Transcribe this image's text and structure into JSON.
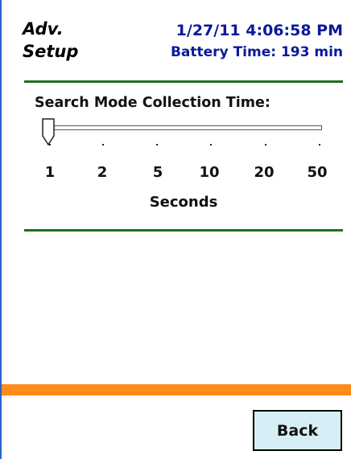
{
  "header": {
    "title_line1": "Adv.",
    "title_line2": "Setup",
    "datetime": "1/27/11 4:06:58 PM",
    "battery": "Battery Time: 193 min"
  },
  "setting": {
    "label": "Search Mode Collection Time:",
    "ticks": [
      "1",
      "2",
      "5",
      "10",
      "20",
      "50"
    ],
    "selected": "1",
    "unit": "Seconds"
  },
  "footer": {
    "back_label": "Back"
  },
  "colors": {
    "title_blue": "#0a1a9a",
    "rule_green": "#1f6f1f",
    "accent_orange": "#ff8c1a",
    "button_bg": "#d6eef5"
  }
}
